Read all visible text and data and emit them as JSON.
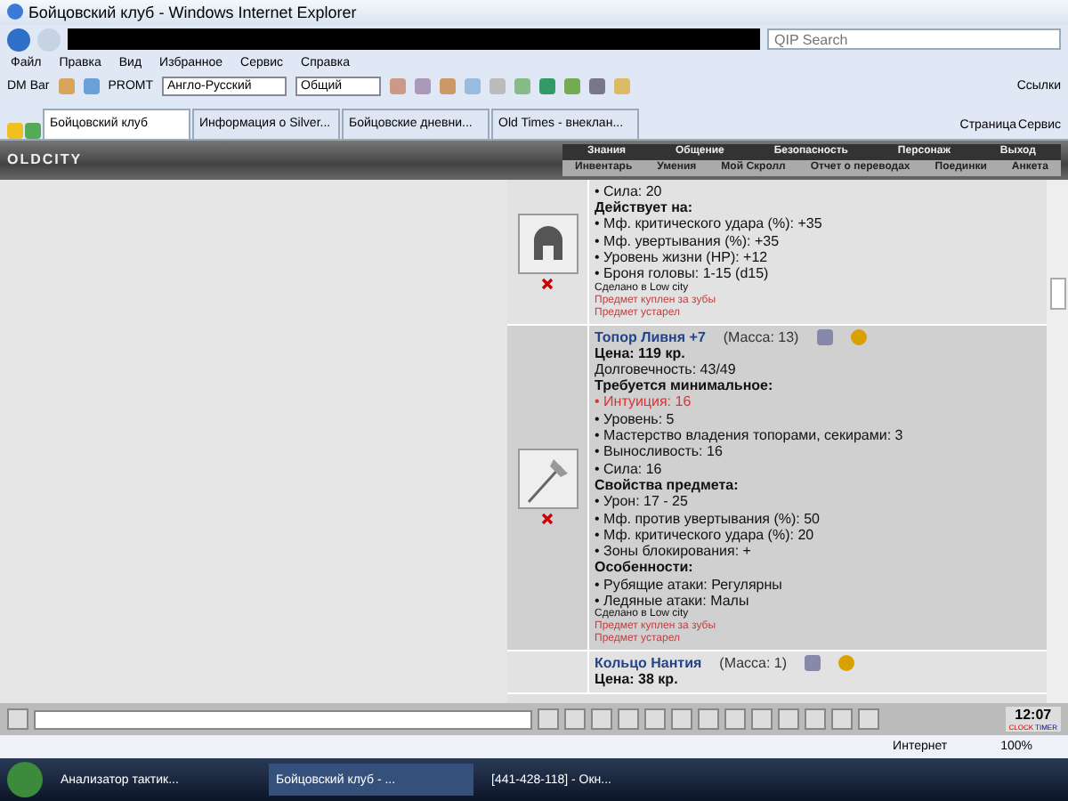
{
  "window": {
    "title": "Бойцовский клуб - Windows Internet Explorer"
  },
  "search": {
    "placeholder": "QIP Search"
  },
  "menu": [
    "Файл",
    "Правка",
    "Вид",
    "Избранное",
    "Сервис",
    "Справка"
  ],
  "toolbar": {
    "label": "DM Bar",
    "promt": "PROMT",
    "direction": "Англо-Русский",
    "topic": "Общий",
    "links": "Ссылки"
  },
  "tabs": [
    {
      "label": "Бойцовский клуб",
      "selected": true
    },
    {
      "label": "Информация о Silver...",
      "selected": false
    },
    {
      "label": "Бойцовские дневни...",
      "selected": false
    },
    {
      "label": "Old Times - внеклан...",
      "selected": false
    }
  ],
  "command_bar": [
    "Страница",
    "Сервис"
  ],
  "game": {
    "logo": "OLDCITY",
    "nav": [
      "Знания",
      "Общение",
      "Безопасность",
      "Персонаж",
      "Выход"
    ],
    "subnav": [
      "Инвентарь",
      "Умения",
      "Мой Скролл",
      "Отчет о переводах",
      "Поединки",
      "Анкета"
    ]
  },
  "items": [
    {
      "kind": "helmet",
      "lines": [
        {
          "kind": "plain",
          "text": "• Сила: 20"
        },
        {
          "kind": "heading",
          "text": "Действует на:"
        },
        {
          "kind": "plain",
          "text": "• Мф. критического удара (%): +35"
        },
        {
          "kind": "plain",
          "text": "• Мф. увертывания (%): +35"
        },
        {
          "kind": "plain",
          "text": "• Уровень жизни (HP): +12"
        },
        {
          "kind": "plain",
          "text": "• Броня головы: 1-15 (d15)"
        },
        {
          "kind": "note",
          "text": "Сделано в Low city"
        },
        {
          "kind": "warning",
          "text": "Предмет куплен за зубы"
        },
        {
          "kind": "warning",
          "text": "Предмет устарел"
        }
      ]
    },
    {
      "kind": "axe",
      "name": "Топор Ливня +7",
      "mass": "(Масса: 13)",
      "lines": [
        {
          "kind": "heading",
          "text": "Цена: 119 кр."
        },
        {
          "kind": "plain",
          "text": "Долговечность: 43/49"
        },
        {
          "kind": "heading",
          "text": "Требуется минимальное:"
        },
        {
          "kind": "unmet",
          "text": "• Интуиция: 16"
        },
        {
          "kind": "plain",
          "text": "• Уровень: 5"
        },
        {
          "kind": "plain",
          "text": "• Мастерство владения топорами, секирами: 3"
        },
        {
          "kind": "plain",
          "text": "• Выносливость: 16"
        },
        {
          "kind": "plain",
          "text": "• Сила: 16"
        },
        {
          "kind": "heading",
          "text": "Свойства предмета:"
        },
        {
          "kind": "plain",
          "text": "• Урон: 17 - 25"
        },
        {
          "kind": "plain",
          "text": "• Мф. против увертывания (%): 50"
        },
        {
          "kind": "plain",
          "text": "• Мф. критического удара (%): 20"
        },
        {
          "kind": "plain",
          "text": "• Зоны блокирования: +"
        },
        {
          "kind": "heading",
          "text": "Особенности:"
        },
        {
          "kind": "plain",
          "text": "• Рубящие атаки: Регулярны"
        },
        {
          "kind": "plain",
          "text": "• Ледяные атаки: Малы"
        },
        {
          "kind": "note",
          "text": "Сделано в Low city"
        },
        {
          "kind": "warning",
          "text": "Предмет куплен за зубы"
        },
        {
          "kind": "warning",
          "text": "Предмет устарел"
        }
      ]
    },
    {
      "kind": "empty",
      "name": "Кольцо Нантия",
      "mass": "(Масса: 1)",
      "lines": [
        {
          "kind": "heading",
          "text": "Цена: 38 кр."
        }
      ]
    }
  ],
  "chat": {
    "clock": "12:07",
    "clock_label": "CLOCK",
    "timer_label": "TIMER"
  },
  "status_bar": {
    "zone": "Интернет",
    "zoom": "100%"
  },
  "taskbar": [
    "Анализатор тактик...",
    "Бойцовский клуб - ...",
    "[441-428-118] - Окн..."
  ]
}
